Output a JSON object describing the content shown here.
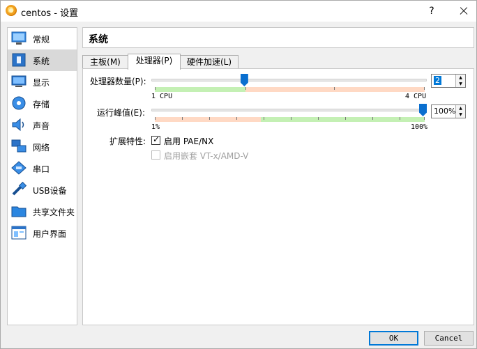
{
  "window": {
    "title": "centos - 设置",
    "help_label": "?"
  },
  "sidebar": {
    "items": [
      {
        "label": "常规",
        "icon": "general-icon"
      },
      {
        "label": "系统",
        "icon": "system-icon",
        "selected": true
      },
      {
        "label": "显示",
        "icon": "display-icon"
      },
      {
        "label": "存储",
        "icon": "storage-icon"
      },
      {
        "label": "声音",
        "icon": "audio-icon"
      },
      {
        "label": "网络",
        "icon": "network-icon"
      },
      {
        "label": "串口",
        "icon": "serial-port-icon"
      },
      {
        "label": "USB设备",
        "icon": "usb-icon"
      },
      {
        "label": "共享文件夹",
        "icon": "shared-folder-icon"
      },
      {
        "label": "用户界面",
        "icon": "user-interface-icon"
      }
    ]
  },
  "header": {
    "title": "系统"
  },
  "tabs": [
    {
      "label": "主板(M)"
    },
    {
      "label": "处理器(P)",
      "active": true
    },
    {
      "label": "硬件加速(L)"
    }
  ],
  "processor": {
    "cpu_count_label": "处理器数量(P):",
    "cpu_min_label": "1 CPU",
    "cpu_max_label": "4 CPU",
    "cpu_value": "2",
    "cpu_fraction": 0.333,
    "cap_label": "运行峰值(E):",
    "cap_min_label": "1%",
    "cap_max_label": "100%",
    "cap_value": "100%",
    "cap_fraction": 1.0,
    "ext_label": "扩展特性:",
    "pae_label": "启用 PAE/NX",
    "pae_checked": true,
    "nested_label": "启用嵌套 VT-x/AMD-V",
    "nested_checked": false,
    "nested_enabled": false
  },
  "buttons": {
    "ok": "OK",
    "cancel": "Cancel"
  },
  "colors": {
    "accent": "#0a6fcf",
    "good": "#c4f0b4",
    "warn": "#ffd9c4",
    "selected": "#d9d9d9"
  }
}
